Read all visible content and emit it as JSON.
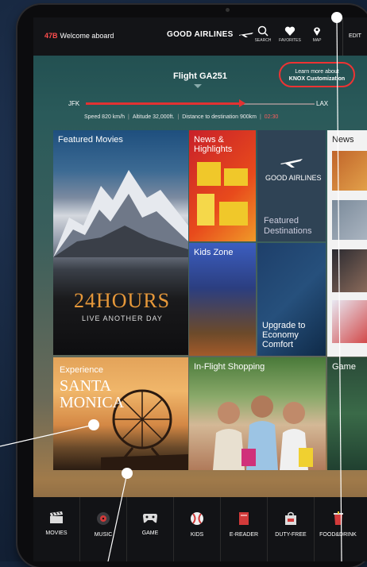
{
  "topbar": {
    "seat_number": "47B",
    "welcome": "Welcome aboard",
    "brand": "GOOD AIRLINES",
    "buttons": [
      {
        "label": "SEARCH",
        "icon": "search-icon"
      },
      {
        "label": "FAVORITES",
        "icon": "heart-icon"
      },
      {
        "label": "MAP",
        "icon": "map-pin-icon"
      }
    ],
    "edit_label": "EDIT"
  },
  "flight": {
    "title": "Flight GA251",
    "knox_line1": "Learn more about",
    "knox_line2": "KNOX Customization",
    "origin": "JFK",
    "destination": "LAX",
    "progress": 0.69,
    "speed": "Speed 820 km/h",
    "altitude": "Altitude 32,000ft.",
    "distance": "Distance to destination 900km",
    "time": "02:30"
  },
  "tiles": {
    "featured_movies": "Featured Movies",
    "movie_title": "24HOURS",
    "movie_sub": "LIVE ANOTHER DAY",
    "news_highlights": "News & Highlights",
    "gal_brand": "GOOD AIRLINES",
    "featured_destinations": "Featured Destinations",
    "news": "News",
    "kids_zone": "Kids Zone",
    "upgrade": "Upgrade to Economy Comfort",
    "experience": "Experience",
    "santa_monica": "SANTA MONICA",
    "inflight_shopping": "In-Flight Shopping",
    "game": "Game"
  },
  "bottom_nav": [
    {
      "label": "MOVIES",
      "icon": "clapperboard-icon"
    },
    {
      "label": "MUSIC",
      "icon": "music-icon"
    },
    {
      "label": "GAME",
      "icon": "gamepad-icon"
    },
    {
      "label": "KIDS",
      "icon": "ball-icon"
    },
    {
      "label": "E-READER",
      "icon": "book-icon"
    },
    {
      "label": "DUTY-FREE",
      "icon": "bag-icon"
    },
    {
      "label": "FOOD&DRINK",
      "icon": "cup-icon"
    }
  ],
  "colors": {
    "accent": "#e23232",
    "background": "#15243a"
  }
}
